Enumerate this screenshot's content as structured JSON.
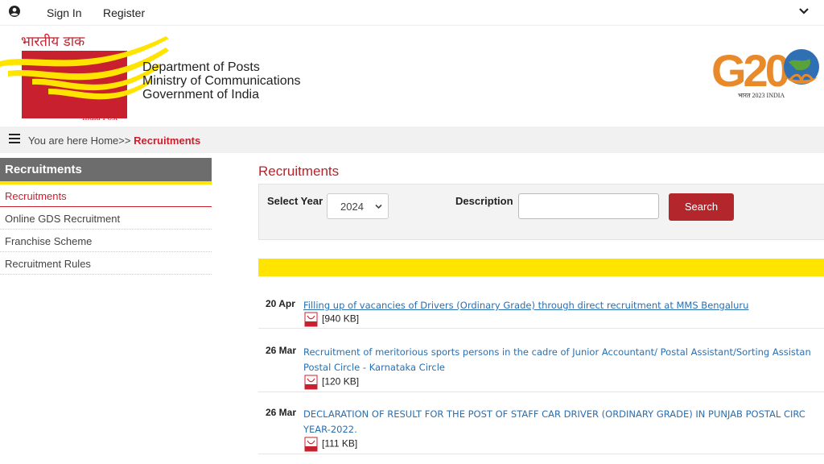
{
  "topbar": {
    "sign_in": "Sign In",
    "register": "Register",
    "icons": [
      "user-icon",
      "chevron-down-icon"
    ]
  },
  "header": {
    "logo_hindi": "भारतीय डाक",
    "logo_caption": "India Post",
    "dept_lines": [
      "Department of Posts",
      "Ministry of Communications",
      "Government of India"
    ],
    "g20_text": "G20",
    "g20_sub": "भारत 2023 INDIA",
    "colors": {
      "brand_red": "#c8202e",
      "brand_yellow": "#ffe400"
    }
  },
  "breadcrumb": {
    "prefix": "You are here",
    "home": "Home>>",
    "current": "Recruitments"
  },
  "sidebar": {
    "title": "Recruitments",
    "items": [
      {
        "label": "Recruitments",
        "active": true
      },
      {
        "label": "Online GDS Recruitment",
        "active": false
      },
      {
        "label": "Franchise Scheme",
        "active": false
      },
      {
        "label": "Recruitment Rules",
        "active": false
      }
    ]
  },
  "main": {
    "title": "Recruitments",
    "filter": {
      "year_label": "Select Year",
      "year_value": "2024",
      "desc_label": "Description",
      "desc_value": "",
      "search_label": "Search"
    },
    "entries": [
      {
        "date": "20 Apr",
        "title_lines": [
          "Filling up of vacancies of Drivers (Ordinary Grade) through direct recruitment at MMS Bengaluru"
        ],
        "size": "[940 KB]",
        "underlined": true
      },
      {
        "date": "26 Mar",
        "title_lines": [
          "Recruitment of meritorious sports persons in the cadre of Junior Accountant/ Postal Assistant/Sorting Assistan",
          "Postal Circle - Karnataka Circle"
        ],
        "size": "[120 KB]",
        "underlined": false
      },
      {
        "date": "26 Mar",
        "title_lines": [
          "DECLARATION OF RESULT FOR THE POST OF STAFF CAR DRIVER (ORDINARY GRADE) IN PUNJAB POSTAL CIRC",
          "YEAR-2022."
        ],
        "size": "[111 KB]",
        "underlined": false
      }
    ]
  }
}
